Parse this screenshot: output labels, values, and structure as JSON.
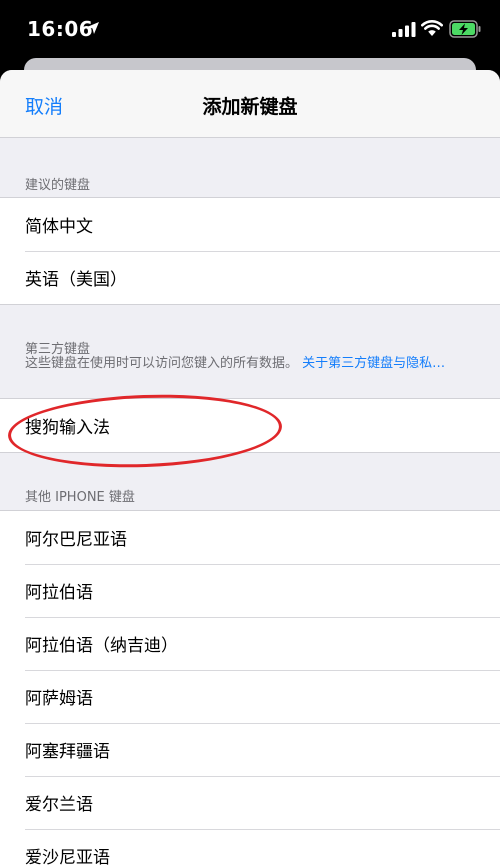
{
  "status": {
    "time": "16:06"
  },
  "nav": {
    "cancel": "取消",
    "title": "添加新键盘"
  },
  "suggested": {
    "header": "建议的键盘",
    "items": [
      "简体中文",
      "英语（美国）"
    ]
  },
  "third_party": {
    "header": "第三方键盘",
    "note": "这些键盘在使用时可以访问您键入的所有数据。",
    "link": "关于第三方键盘与隐私…",
    "items": [
      "搜狗输入法"
    ]
  },
  "other": {
    "header": "其他 IPHONE 键盘",
    "items": [
      "阿尔巴尼亚语",
      "阿拉伯语",
      "阿拉伯语（纳吉迪）",
      "阿萨姆语",
      "阿塞拜疆语",
      "爱尔兰语",
      "爱沙尼亚语"
    ]
  },
  "colors": {
    "accent": "#147efb",
    "annotation": "#e0272a"
  }
}
